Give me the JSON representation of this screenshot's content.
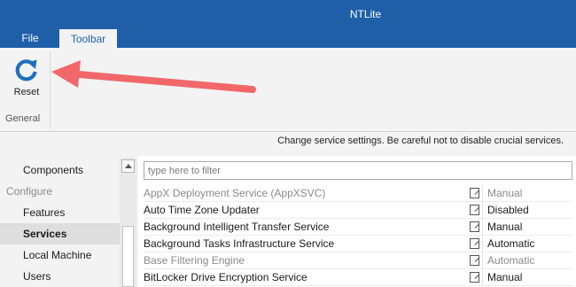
{
  "window": {
    "title": "NTLite"
  },
  "ribbon": {
    "tabs": [
      {
        "label": "File"
      },
      {
        "label": "Toolbar"
      }
    ],
    "reset_label": "Reset",
    "group_label": "General"
  },
  "hint": "Change service settings. Be careful not to disable crucial services.",
  "sidebar": {
    "items": [
      {
        "label": "Components"
      },
      {
        "label": "Configure"
      },
      {
        "label": "Features"
      },
      {
        "label": "Services"
      },
      {
        "label": "Local Machine"
      },
      {
        "label": "Users"
      }
    ]
  },
  "filter": {
    "placeholder": "type here to filter",
    "value": ""
  },
  "services": [
    {
      "name": "AppX Deployment Service (AppXSVC)",
      "startup": "Manual",
      "dimmed": true
    },
    {
      "name": "Auto Time Zone Updater",
      "startup": "Disabled",
      "dimmed": false
    },
    {
      "name": "Background Intelligent Transfer Service",
      "startup": "Manual",
      "dimmed": false
    },
    {
      "name": "Background Tasks Infrastructure Service",
      "startup": "Automatic",
      "dimmed": false
    },
    {
      "name": "Base Filtering Engine",
      "startup": "Automatic",
      "dimmed": true
    },
    {
      "name": "BitLocker Drive Encryption Service",
      "startup": "Manual",
      "dimmed": false
    }
  ],
  "colors": {
    "title_bar": "#1f5fa8",
    "reset_icon": "#1f6fbf",
    "annotation_arrow": "#f2686a"
  },
  "icons": {
    "reset": "refresh-icon",
    "edit": "edit-icon",
    "scroll_up": "chevron-up-icon",
    "annotation": "arrow-annotation"
  }
}
